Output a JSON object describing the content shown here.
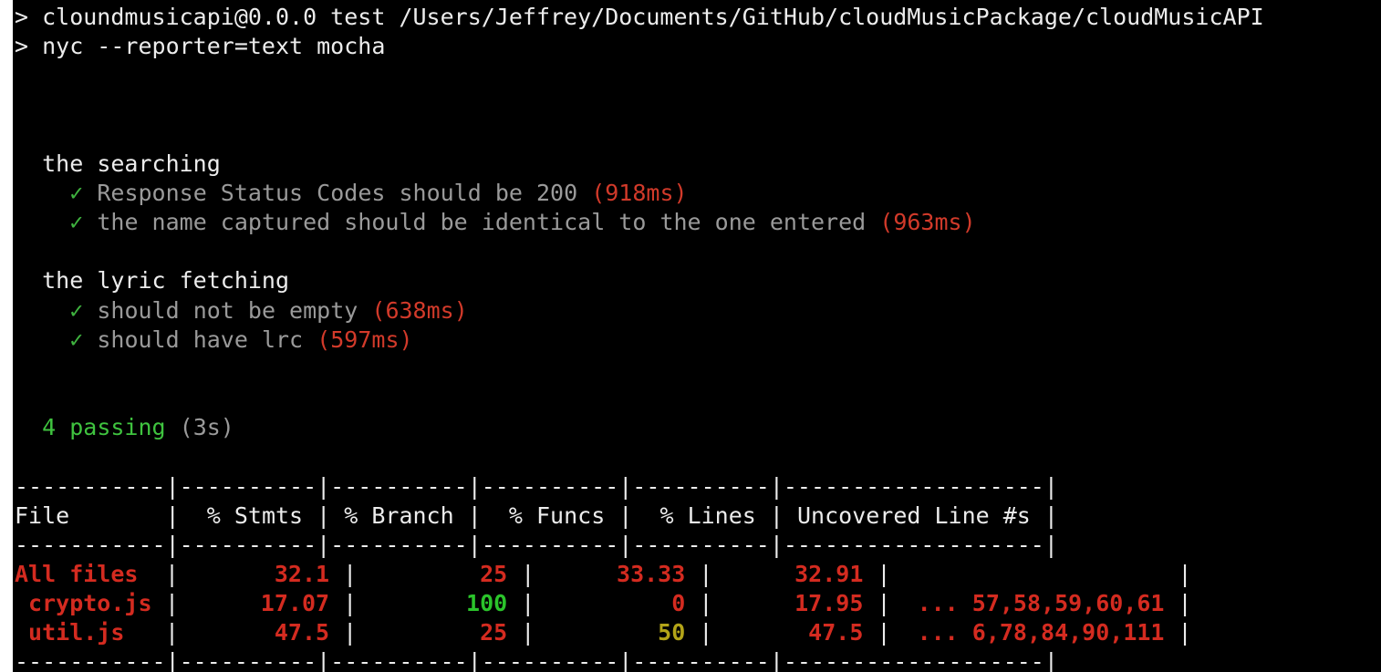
{
  "header": {
    "line1": "> cloundmusicapi@0.0.0 test /Users/Jeffrey/Documents/GitHub/cloudMusicPackage/cloudMusicAPI",
    "line2": "> nyc --reporter=text mocha"
  },
  "suites": [
    {
      "title": "the searching",
      "tests": [
        {
          "check": "✓",
          "name": "Response Status Codes should be 200",
          "duration": "(918ms)"
        },
        {
          "check": "✓",
          "name": "the name captured should be identical to the one entered",
          "duration": "(963ms)"
        }
      ]
    },
    {
      "title": "the lyric fetching",
      "tests": [
        {
          "check": "✓",
          "name": "should not be empty",
          "duration": "(638ms)"
        },
        {
          "check": "✓",
          "name": "should have lrc",
          "duration": "(597ms)"
        }
      ]
    }
  ],
  "summary": {
    "passing": "4 passing",
    "time": "(3s)"
  },
  "coverage": {
    "separator_row": "-----------|----------|----------|----------|----------|-------------------|",
    "headers": [
      "File",
      "% Stmts",
      "% Branch",
      "% Funcs",
      "% Lines",
      "Uncovered Line #s"
    ],
    "rows": [
      {
        "file": "All files",
        "stmts": "32.1",
        "branch": "25",
        "funcs": "33.33",
        "lines": "32.91",
        "uncovered": ""
      },
      {
        "file": " crypto.js",
        "stmts": "17.07",
        "branch": "100",
        "funcs": "0",
        "lines": "17.95",
        "uncovered": "... 57,58,59,60,61"
      },
      {
        "file": " util.js",
        "stmts": "47.5",
        "branch": "25",
        "funcs": "50",
        "lines": "47.5",
        "uncovered": "... 6,78,84,90,111"
      }
    ]
  },
  "colors": {
    "background": "#000000",
    "text": "#ececec",
    "dim_text": "#9a9a9a",
    "check": "#3fb33f",
    "duration": "#d23a2a",
    "low_coverage": "#d42b20",
    "high_coverage": "#2bc42b",
    "medium_coverage": "#b3a418"
  }
}
